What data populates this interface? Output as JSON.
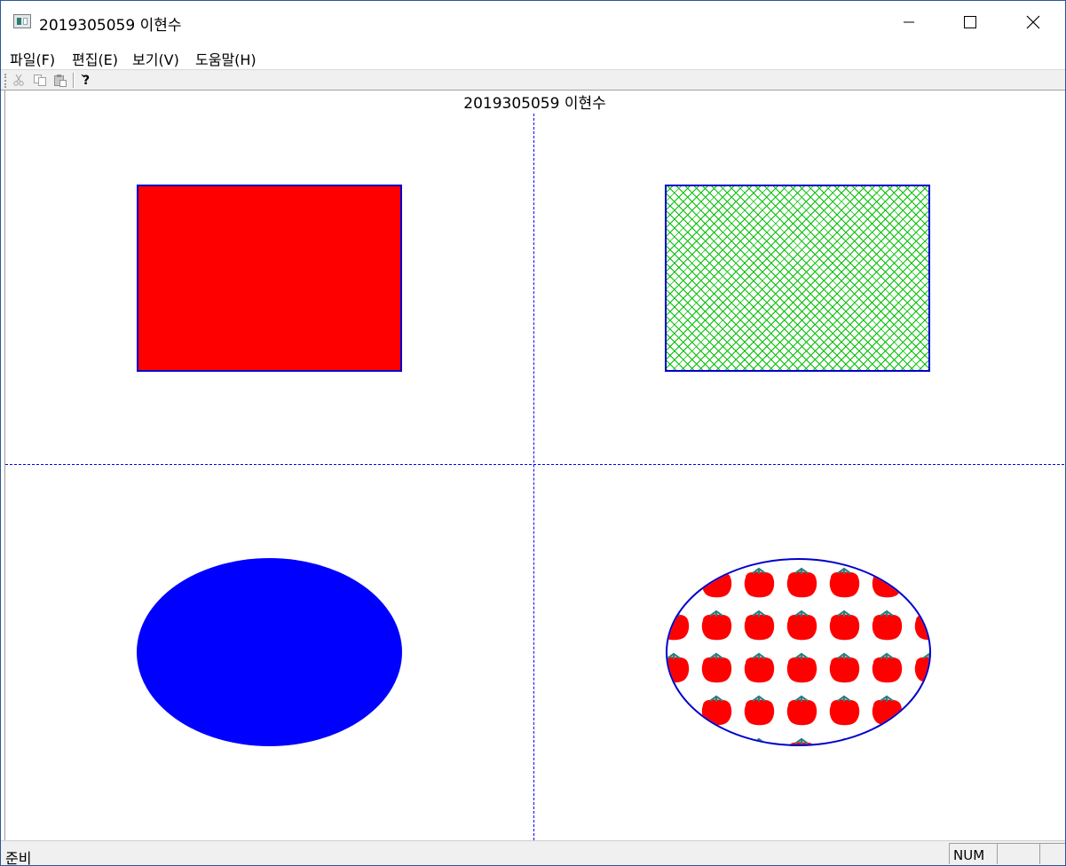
{
  "window": {
    "title": "2019305059 이현수",
    "minimize_icon": "minimize-icon",
    "maximize_icon": "maximize-icon",
    "close_icon": "close-icon"
  },
  "menu": {
    "items": [
      "파일(F)",
      "편집(E)",
      "보기(V)",
      "도움말(H)"
    ]
  },
  "toolbar": {
    "buttons": [
      {
        "icon": "cut-icon",
        "enabled": false
      },
      {
        "icon": "copy-icon",
        "enabled": false
      },
      {
        "icon": "paste-icon",
        "enabled": false
      },
      {
        "icon": "help-icon",
        "enabled": true
      }
    ]
  },
  "client": {
    "heading": "2019305059 이현수",
    "divider_color": "#0000ff",
    "shapes": [
      {
        "kind": "rectangle",
        "fill": "solid",
        "fill_color": "#ff0000",
        "border_color": "#0000cc"
      },
      {
        "kind": "rectangle",
        "fill": "crosshatch",
        "fill_color": "#00c000",
        "border_color": "#0000cc"
      },
      {
        "kind": "ellipse",
        "fill": "solid",
        "fill_color": "#0000ff",
        "border_color": "#0000ff"
      },
      {
        "kind": "ellipse",
        "fill": "tomato-pattern",
        "fill_color": "#ff0000",
        "border_color": "#0000cc"
      }
    ]
  },
  "status": {
    "text": "준비",
    "num": "NUM"
  }
}
